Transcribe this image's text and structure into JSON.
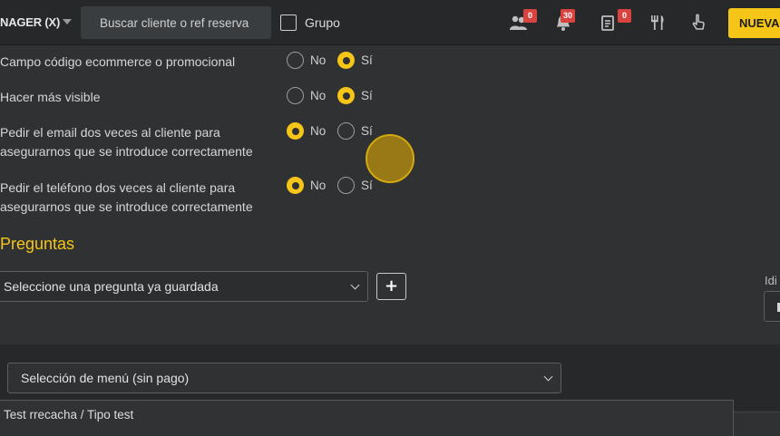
{
  "header": {
    "brand": "NAGER (X)",
    "search_placeholder": "Buscar cliente o ref reserva",
    "grupo_label": "Grupo",
    "badges": {
      "users": "0",
      "bell": "30",
      "tasks": "0"
    },
    "new_button": "NUEVA"
  },
  "settings": {
    "no_label": "No",
    "si_label": "Sí",
    "rows": [
      {
        "line1": "Campo código ecommerce o promocional",
        "line2": "",
        "value": "si"
      },
      {
        "line1": "Hacer más visible",
        "line2": "",
        "value": "si"
      },
      {
        "line1": "Pedir el email dos veces al cliente para",
        "line2": "asegurarnos que se introduce correctamente",
        "value": "no"
      },
      {
        "line1": "Pedir el teléfono dos veces al cliente para",
        "line2": "asegurarnos que se introduce correctamente",
        "value": "no"
      }
    ]
  },
  "preguntas": {
    "title": "Preguntas",
    "select_value": "Seleccione una pregunta ya guardada",
    "add_button": "+",
    "idioma_label": "Idi"
  },
  "menu": {
    "select_value": "Selección de menú (sin pago)",
    "item": "Test rrecacha / Tipo test"
  },
  "colors": {
    "accent": "#f5c518",
    "badge": "#d9433f",
    "background": "#2f3133",
    "topbar": "#26282a"
  }
}
